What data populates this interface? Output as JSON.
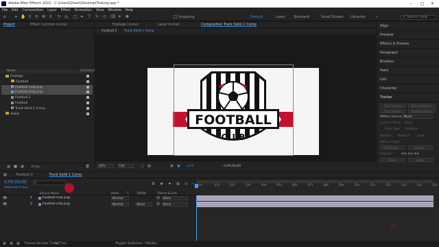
{
  "app": {
    "title": "Adobe After Effects 2022 - C:\\Users\\Ghani\\Desktop\\Traking.aep *"
  },
  "menu": [
    "File",
    "Edit",
    "Composition",
    "Layer",
    "Effect",
    "Animation",
    "View",
    "Window",
    "Help"
  ],
  "toolbar": {
    "snapping": "Snapping",
    "workspaces": [
      "Default",
      "Learn",
      "Standard",
      "Small Screen",
      "Libraries"
    ],
    "active_workspace": "Default",
    "search_placeholder": "Search Help"
  },
  "project": {
    "tabs": [
      "Project",
      "Effect Controls (none)"
    ],
    "col_name": "Name",
    "col_comment": "Comment",
    "items": [
      {
        "label": "Footage",
        "kind": "folder",
        "highlight": false
      },
      {
        "label": "Football",
        "kind": "folder",
        "highlight": false
      },
      {
        "label": "Football-club.png",
        "kind": "image",
        "highlight": true
      },
      {
        "label": "Football-club.png",
        "kind": "image",
        "highlight": true
      },
      {
        "label": "Football 2",
        "kind": "comp",
        "highlight": false
      },
      {
        "label": "Football",
        "kind": "comp",
        "highlight": false
      },
      {
        "label": "Track Solid 1 Comp",
        "kind": "comp",
        "highlight": false
      },
      {
        "label": "Solids",
        "kind": "folder",
        "highlight": false
      }
    ],
    "bpc": "16 bpc"
  },
  "viewer": {
    "tabs": [
      "Footage (none)",
      "Layer (none)",
      "Composition Track Solid 1 Comp"
    ],
    "breadcrumbs": [
      "Football 2",
      "Track Solid 1 Comp"
    ],
    "zoom": "25%",
    "resolution": "Full",
    "timecode": "0;00;00;00",
    "exposure": "+0.0",
    "logo_line1": "FOOTBALL",
    "logo_line2": "CLUB"
  },
  "right_panel": {
    "items": [
      "Align",
      "Preview",
      "Effects & Presets",
      "Paragraph",
      "Brushes",
      "Paint",
      "Info",
      "Character",
      "Tracker"
    ],
    "tracker": {
      "buttons": [
        "Track Camera",
        "Warp Stabilizer",
        "Track Motion",
        "Stabilize Motion"
      ],
      "motion_source_label": "Motion Source:",
      "motion_source_value": "None",
      "current_track_label": "Current Track:",
      "current_track_value": "None",
      "track_type_label": "Track Type:",
      "track_type_value": "Stabilize",
      "checks": [
        "Position",
        "Rotation",
        "Scale"
      ],
      "motion_target": "Motion Target:",
      "edit_target": "Edit Target...",
      "options": "Options...",
      "analyze_label": "Analyze:",
      "reset": "Reset",
      "apply": "Apply"
    }
  },
  "timeline": {
    "tabs": [
      "Football 2",
      "Track Solid 1 Comp"
    ],
    "timecode": "0;00;00;00",
    "frame_info": "00000 (29.97 fps)",
    "headers": {
      "source": "Source Name",
      "mode": "Mode",
      "t": "T",
      "trkmat": "TrkMat",
      "parent": "Parent & Link"
    },
    "layers": [
      {
        "num": "1",
        "name": "Football-club.png",
        "mode": "Normal",
        "trkmat": "",
        "parent": "None"
      },
      {
        "num": "2",
        "name": "Football-club.png",
        "mode": "Normal",
        "trkmat": "None",
        "parent": "None"
      }
    ],
    "ruler": [
      "0s",
      "01s",
      "02s",
      "03s",
      "04s",
      "05s",
      "06s",
      "07s",
      "08s",
      "09s",
      "10s",
      "11s",
      "12s",
      "13s",
      "14s",
      "15s"
    ]
  },
  "status": {
    "frame_render_label": "Frame Render Time:",
    "frame_render_value": "127ms",
    "toggle": "Toggle Switches / Modes"
  },
  "colors": {
    "accent": "#2d8ceb",
    "logo_red": "#c8102e",
    "playhead": "#3aa0ff",
    "bar": "#a7a2b5"
  }
}
